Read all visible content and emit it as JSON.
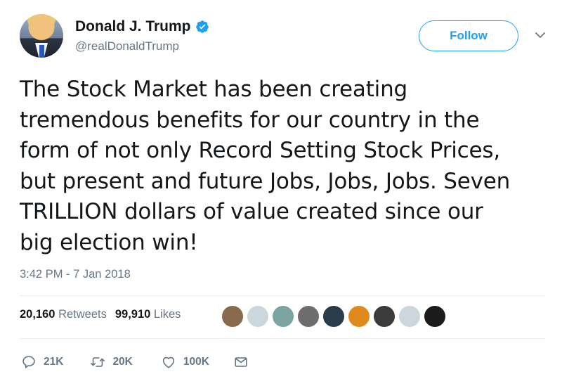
{
  "author": {
    "display_name": "Donald J. Trump",
    "handle": "@realDonaldTrump",
    "verified": true,
    "verified_color": "#1da1f2"
  },
  "follow_label": "Follow",
  "tweet": {
    "text": "The Stock Market has been creating\ntremendous benefits for our country in the\nform of not only Record Setting Stock Prices,\nbut present and future Jobs, Jobs, Jobs. Seven\nTRILLION dollars of value created since our\nbig election win!",
    "timestamp": "3:42 PM - 7 Jan 2018"
  },
  "stats": {
    "retweets_count": "20,160",
    "retweets_label": "Retweets",
    "likes_count": "99,910",
    "likes_label": "Likes"
  },
  "liker_avatars": [
    "#8a6a4f",
    "#ccd6dd",
    "#7aa5a0",
    "#6d6d6d",
    "#2a3b4c",
    "#e08a1e",
    "#3b3b3b",
    "#ccd6dd",
    "#1b1b1b"
  ],
  "actions": {
    "replies": "21K",
    "retweets": "20K",
    "likes": "100K"
  },
  "icons": {
    "reply": "reply-icon",
    "retweet": "retweet-icon",
    "like": "heart-icon",
    "dm": "envelope-icon",
    "more": "chevron-down-icon"
  },
  "colors": {
    "accent": "#1da1f2",
    "secondary_text": "#657786",
    "primary_text": "#14171a"
  }
}
